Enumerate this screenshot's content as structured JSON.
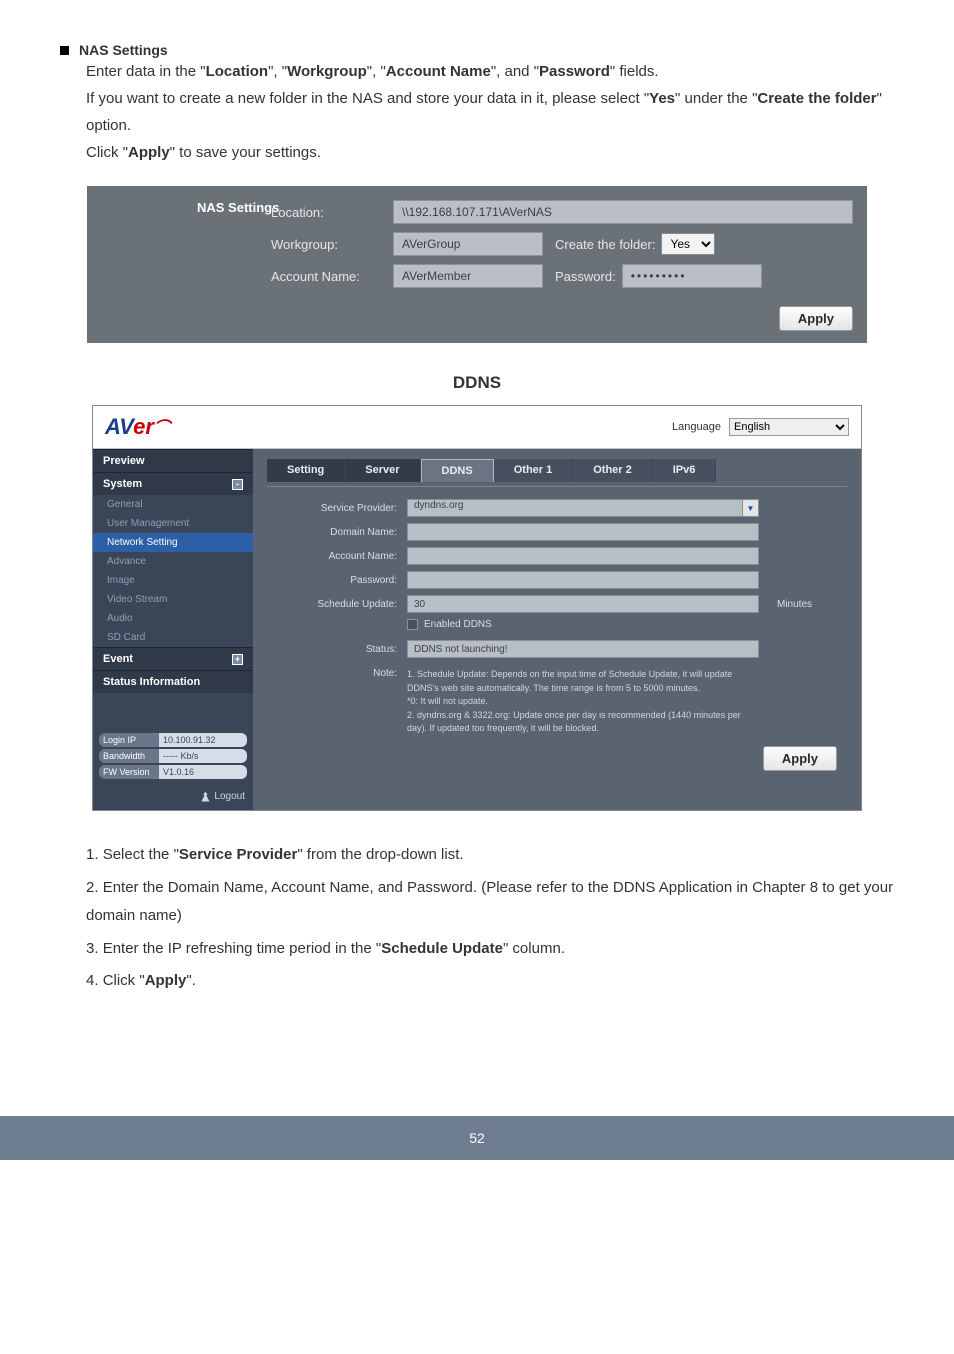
{
  "intro": {
    "heading": "NAS Settings",
    "line1_pre": "Enter data in the ",
    "q_location": "Location",
    "line1_mid1": ", ",
    "q_workgroup": "Workgroup",
    "line1_mid2": ", ",
    "q_account": "Account Name",
    "line1_mid3": ", and ",
    "q_password": "Password",
    "line1_post": " fields.",
    "line2_pre": "If you want to create a new folder in the NAS and store your data in it, please select ",
    "q_yes": "Yes",
    "line2_mid": " under the ",
    "q_create": "Create the folder",
    "line2_post": " option.",
    "apply_pre": "Click ",
    "q_apply": "Apply",
    "apply_post": " to save your settings."
  },
  "nas": {
    "title": "NAS Settings",
    "loc_label": "Location:",
    "loc_val": "\\\\192.168.107.171\\AVerNAS",
    "wg_label": "Workgroup:",
    "wg_val": "AVerGroup",
    "create_label": "Create the folder:",
    "create_val": "Yes",
    "acc_label": "Account Name:",
    "acc_val": "AVerMember",
    "pw_label": "Password:",
    "pw_val": "•••••••••",
    "apply": "Apply"
  },
  "ddns_section": {
    "title": "DDNS",
    "step1_a": "Select the ",
    "step1_b": "Service Provider",
    "step1_c": " from the drop-down list.",
    "step2": "Enter the Domain Name, Account Name, and Password. (Please refer to the DDNS Application in Chapter 8 to get your domain name)",
    "step3_a": "Enter the IP refreshing time period in the ",
    "step3_b": "Schedule Update",
    "step3_c": " column.",
    "step4_a": "Click ",
    "step4_b": "Apply",
    "step4_c": "."
  },
  "ui": {
    "logo_av": "AV",
    "logo_er": "er",
    "lang_label": "Language",
    "lang_val": "English",
    "sb_preview": "Preview",
    "sb_system": "System",
    "sb_general": "General",
    "sb_user": "User Management",
    "sb_net": "Network Setting",
    "sb_adv": "Advance",
    "sb_img": "Image",
    "sb_vs": "Video Stream",
    "sb_audio": "Audio",
    "sb_sd": "SD Card",
    "sb_event": "Event",
    "sb_status": "Status Information",
    "info_login_l": "Login IP",
    "info_login_r": "10.100.91.32",
    "info_bw_l": "Bandwidth",
    "info_bw_r": "----- Kb/s",
    "info_fw_l": "FW Version",
    "info_fw_r": "V1.0.16",
    "logout": "Logout",
    "tab_setting": "Setting",
    "tab_server": "Server",
    "tab_ddns": "DDNS",
    "tab_o1": "Other 1",
    "tab_o2": "Other 2",
    "tab_ipv6": "IPv6",
    "f_sp": "Service Provider:",
    "f_sp_val": "dyndns.org",
    "f_dn": "Domain Name:",
    "f_an": "Account Name:",
    "f_pw": "Password:",
    "f_su": "Schedule Update:",
    "f_su_val": "30",
    "f_su_unit": "Minutes",
    "f_en": "Enabled DDNS",
    "f_status": "Status:",
    "f_status_val": "DDNS not launching!",
    "f_note": "Note:",
    "f_note_val": "1. Schedule Update: Depends on the input time of Schedule Update, it will update DDNS's web site automatically. The time range is from 5 to 5000 minutes.\n*0: It will not update.\n2. dyndns.org & 3322.org: Update once per day is recommended (1440 minutes per day). If updated too frequently, it will be blocked.",
    "apply": "Apply"
  },
  "page_no": "52"
}
